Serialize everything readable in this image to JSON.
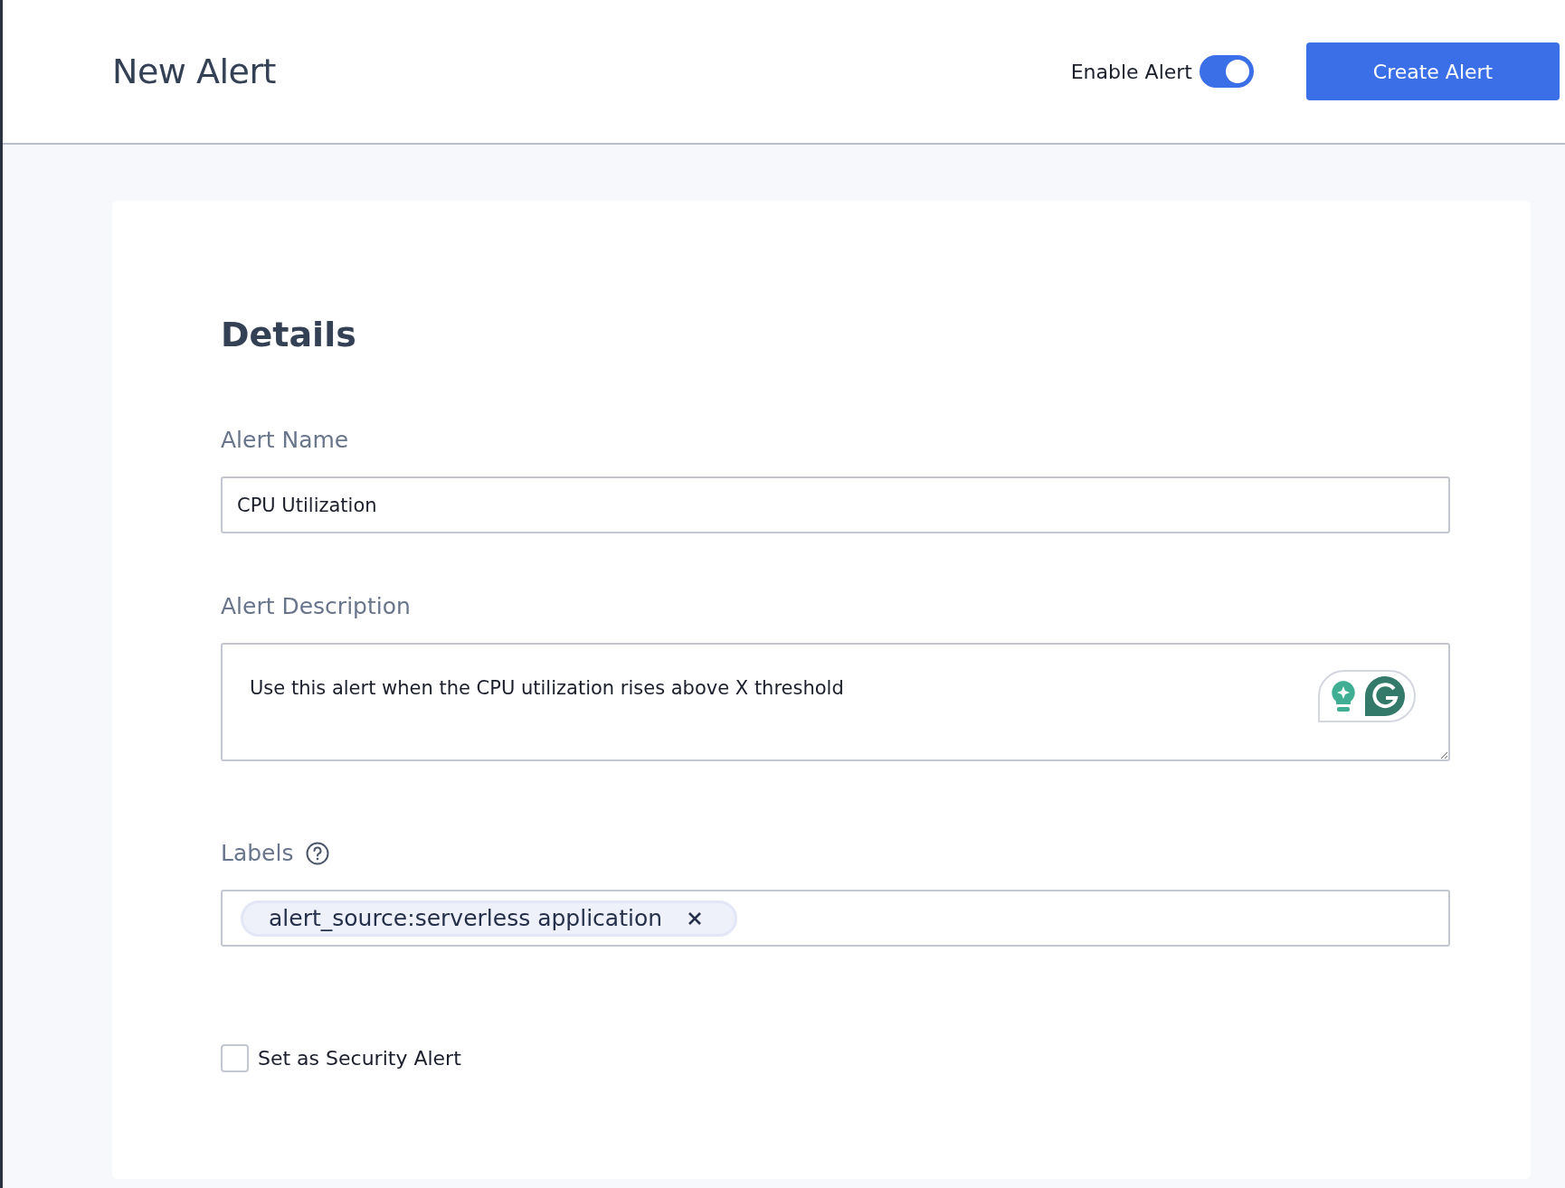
{
  "header": {
    "title": "New Alert",
    "toggle": {
      "label": "Enable Alert",
      "on": true
    },
    "button": "Create Alert"
  },
  "details": {
    "heading": "Details",
    "fields": [
      {
        "kind": "text",
        "label": "Alert Name",
        "value": "CPU Utilization"
      },
      {
        "kind": "textarea",
        "label": "Alert Description",
        "value": "Use this alert when the CPU utilization rises above X threshold"
      },
      {
        "kind": "tags",
        "label": "Labels",
        "help": true,
        "tags": [
          "alert_source:serverless application"
        ]
      }
    ],
    "checkbox": {
      "label": "Set as Security Alert",
      "checked": false
    }
  }
}
